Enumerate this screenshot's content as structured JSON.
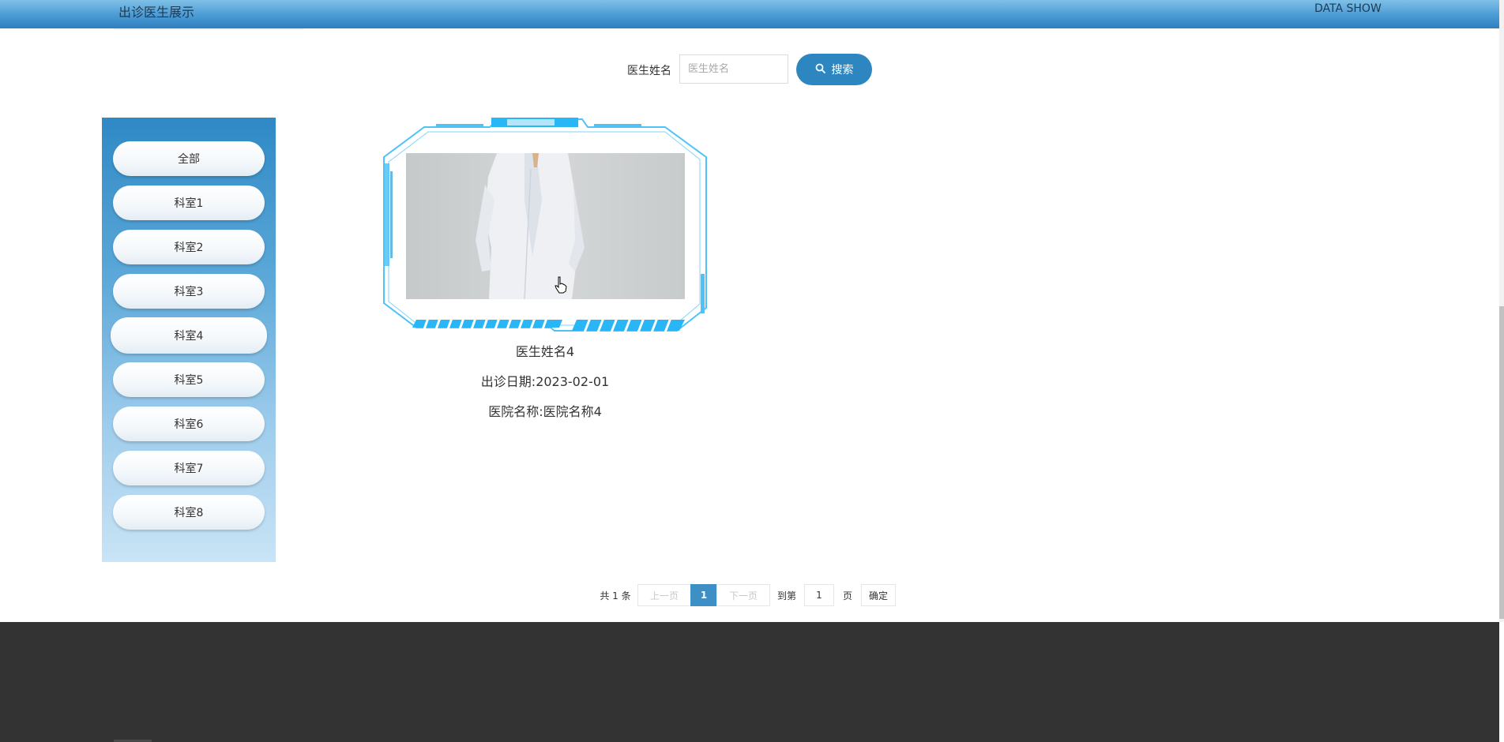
{
  "header": {
    "title": "出诊医生展示",
    "right_text": "DATA SHOW"
  },
  "search": {
    "label": "医生姓名",
    "placeholder": "医生姓名",
    "button_label": "搜索"
  },
  "sidebar": {
    "items": [
      {
        "label": "全部"
      },
      {
        "label": "科室1"
      },
      {
        "label": "科室2"
      },
      {
        "label": "科室3"
      },
      {
        "label": "科室4"
      },
      {
        "label": "科室5"
      },
      {
        "label": "科室6"
      },
      {
        "label": "科室7"
      },
      {
        "label": "科室8"
      }
    ],
    "active_index": 4
  },
  "cards": [
    {
      "name": "医生姓名4",
      "date_text": "出诊日期:2023-02-01",
      "hospital_text": "医院名称:医院名称4"
    }
  ],
  "pagination": {
    "total_text": "共 1 条",
    "prev_label": "上一页",
    "current_page": "1",
    "next_label": "下一页",
    "goto_label": "到第",
    "goto_value": "1",
    "page_unit": "页",
    "confirm_label": "确定"
  },
  "colors": {
    "header_gradient_top": "#7fc0e8",
    "header_gradient_bottom": "#2f7fc0",
    "accent": "#2e86c1",
    "frame_cyan": "#29b6f6",
    "footer": "#333333"
  },
  "icons": {
    "search_button": "search-icon",
    "cursor": "hand-pointer-icon"
  }
}
